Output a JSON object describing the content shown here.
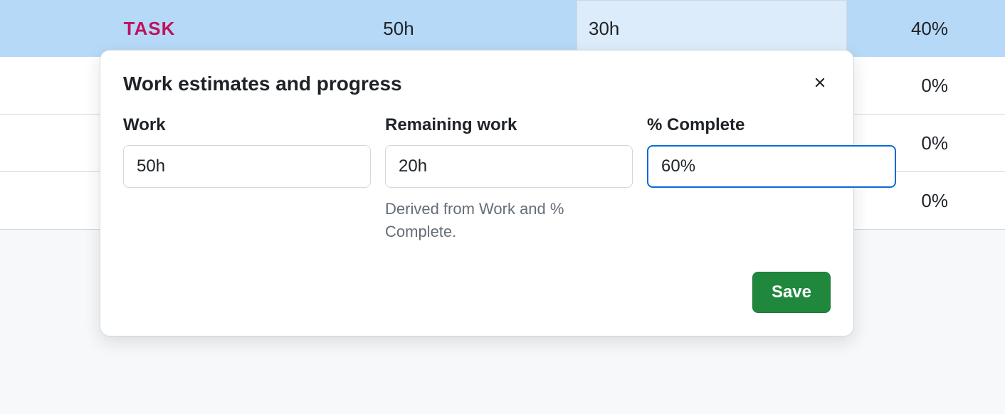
{
  "table": {
    "header": {
      "task": "TASK",
      "work": "50h",
      "remaining": "30h",
      "percent": "40%"
    },
    "rows": [
      {
        "percent": "0%"
      },
      {
        "percent": "0%"
      },
      {
        "percent": "0%"
      }
    ]
  },
  "dialog": {
    "title": "Work estimates and progress",
    "fields": {
      "work": {
        "label": "Work",
        "value": "50h"
      },
      "remaining": {
        "label": "Remaining work",
        "value": "20h",
        "hint": "Derived from Work and % Complete."
      },
      "percent": {
        "label": "% Complete",
        "value": "60%"
      }
    },
    "save_label": "Save"
  }
}
